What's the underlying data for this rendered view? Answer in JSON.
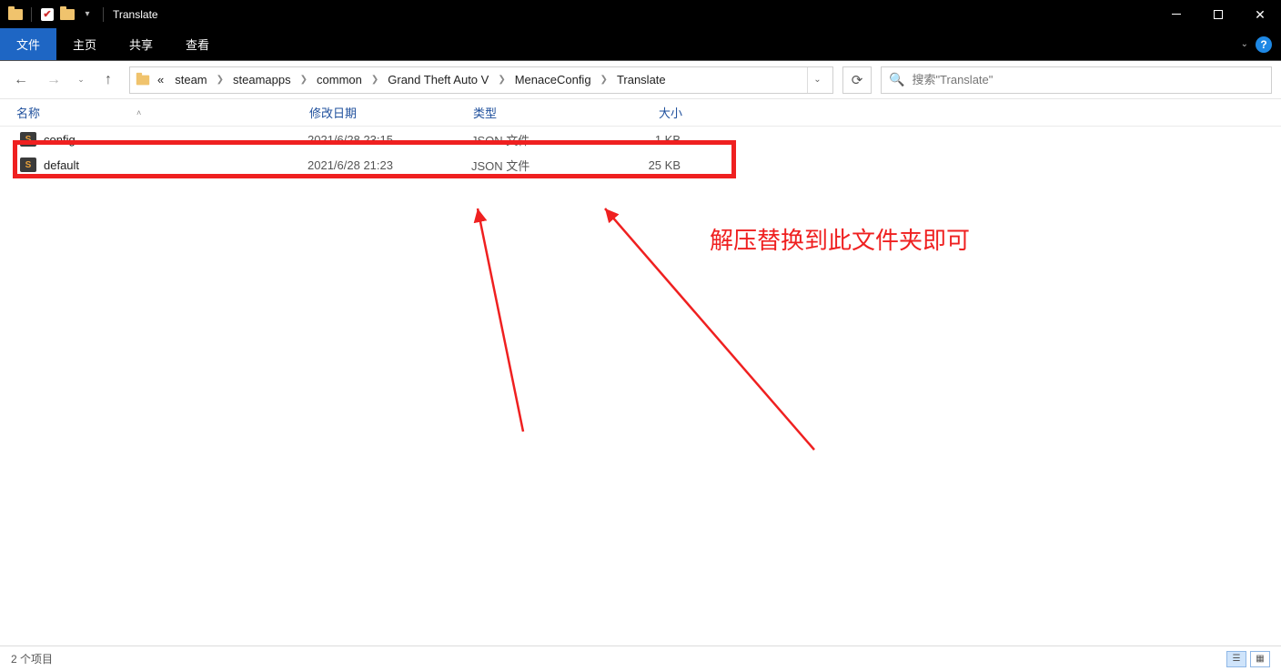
{
  "window": {
    "title": "Translate"
  },
  "ribbon": {
    "tabs": {
      "file": "文件",
      "home": "主页",
      "share": "共享",
      "view": "查看"
    }
  },
  "nav": {
    "crumb_ellipsis": "«",
    "crumbs": [
      "steam",
      "steamapps",
      "common",
      "Grand Theft Auto V",
      "MenaceConfig",
      "Translate"
    ],
    "search_placeholder": "搜索\"Translate\""
  },
  "columns": {
    "name": "名称",
    "date": "修改日期",
    "type": "类型",
    "size": "大小"
  },
  "files": [
    {
      "name": "config",
      "date": "2021/6/28 23:15",
      "type": "JSON 文件",
      "size": "1 KB"
    },
    {
      "name": "default",
      "date": "2021/6/28 21:23",
      "type": "JSON 文件",
      "size": "25 KB"
    }
  ],
  "annotation": {
    "text": "解压替换到此文件夹即可",
    "color": "#ef2020"
  },
  "status": {
    "item_count": "2 个项目"
  }
}
